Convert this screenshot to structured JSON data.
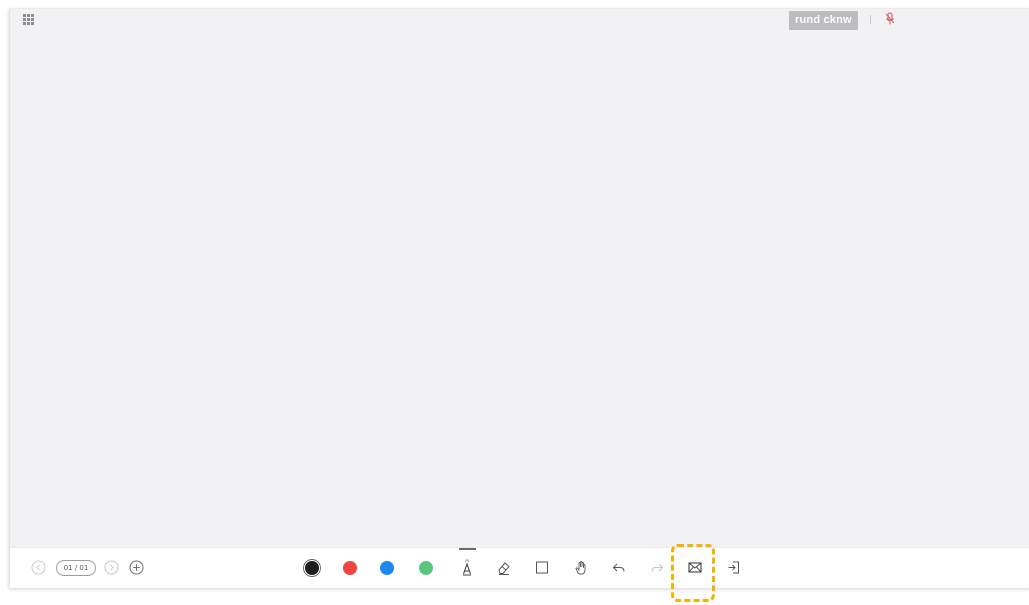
{
  "header": {
    "apps_icon": "grid-icon",
    "username": "rund cknw",
    "mic_icon": "microphone-muted-icon"
  },
  "canvas": {
    "background": "#f2f2f4"
  },
  "toolbar": {
    "page_counter": "01 / 01",
    "nav_icons": [
      "chevron-left-icon",
      "chevron-right-icon",
      "add-page-icon"
    ],
    "colors": [
      {
        "name": "black",
        "hex": "#1e1e1e",
        "selected": true
      },
      {
        "name": "red",
        "hex": "#ee4444",
        "selected": false
      },
      {
        "name": "blue",
        "hex": "#1e88ef",
        "selected": false
      },
      {
        "name": "green",
        "hex": "#5cc57c",
        "selected": false
      }
    ],
    "tools": [
      "pen-icon",
      "eraser-icon",
      "rectangle-icon",
      "hand-icon",
      "undo-icon",
      "redo-icon",
      "mail-icon",
      "exit-icon"
    ],
    "highlighted_tool": "mail-icon",
    "highlight_color": "#f2b400"
  }
}
